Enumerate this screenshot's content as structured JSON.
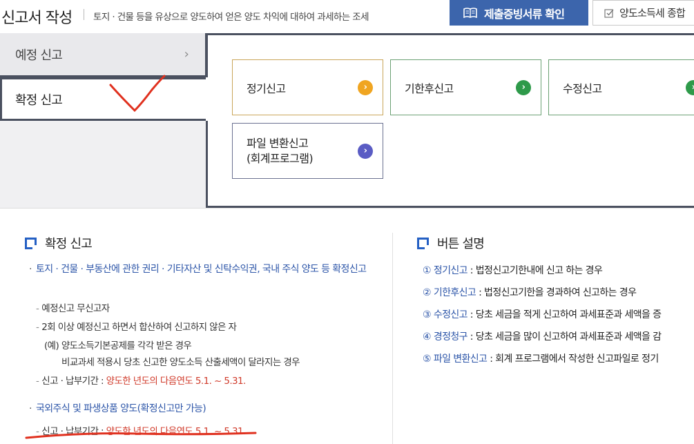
{
  "header": {
    "title": "신고서 작성",
    "description": "토지 · 건물 등을 유상으로 양도하여 얻은 양도 차익에 대하여 과세하는 조세",
    "evidence_button": "제출증빙서류 확인",
    "summary_button": "양도소득세 종합"
  },
  "side_tabs": {
    "preliminary": "예정 신고",
    "final": "확정 신고"
  },
  "options": {
    "regular": "정기신고",
    "late": "기한후신고",
    "amend": "수정신고",
    "file_convert": "파일 변환신고\n(회계프로그램)"
  },
  "final_section": {
    "heading": "확정 신고",
    "item1": {
      "title": "토지 · 건물 · 부동산에 관한 권리 · 기타자산 및 신탁수익권, 국내 주식 양도 등 확정신고",
      "sub1": "예정신고 무신고자",
      "sub2": "2회 이상 예정신고 하면서 합산하여 신고하지 않은 자",
      "ex1": "(예) 양도소득기본공제를 각각 받은 경우",
      "ex2": "비교과세 적용시 당초 신고한 양도소득 산출세액이 달라지는 경우",
      "period_label": "신고 · 납부기간 :",
      "period_value": "양도한 년도의 다음연도 5.1. ~ 5.31."
    },
    "item2": {
      "title": "국외주식 및 파생상품 양도(확정신고만 가능)",
      "period_label": "신고 · 납부기간 :",
      "period_value": "양도한 년도의 다음연도 5.1. ~ 5.31."
    }
  },
  "buttons_section": {
    "heading": "버튼 설명",
    "items": [
      {
        "num": "①",
        "term": "정기신고",
        "desc": " : 법정신고기한내에 신고 하는 경우"
      },
      {
        "num": "②",
        "term": "기한후신고",
        "desc": " : 법정신고기한을 경과하여 신고하는 경우"
      },
      {
        "num": "③",
        "term": "수정신고",
        "desc": " : 당초 세금을 적게 신고하여 과세표준과 세액을 증"
      },
      {
        "num": "④",
        "term": "경정청구",
        "desc": " : 당초 세금을 많이 신고하여 과세표준과 세액을 감"
      },
      {
        "num": "⑤",
        "term": "파일 변환신고",
        "desc": " : 회계 프로그램에서 작성한 신고파일로 정기"
      }
    ]
  },
  "colors": {
    "primary_blue": "#3c65ac",
    "link_blue": "#2c55a8",
    "red_text": "#d03a2a",
    "annotation_red": "#e0301e"
  }
}
